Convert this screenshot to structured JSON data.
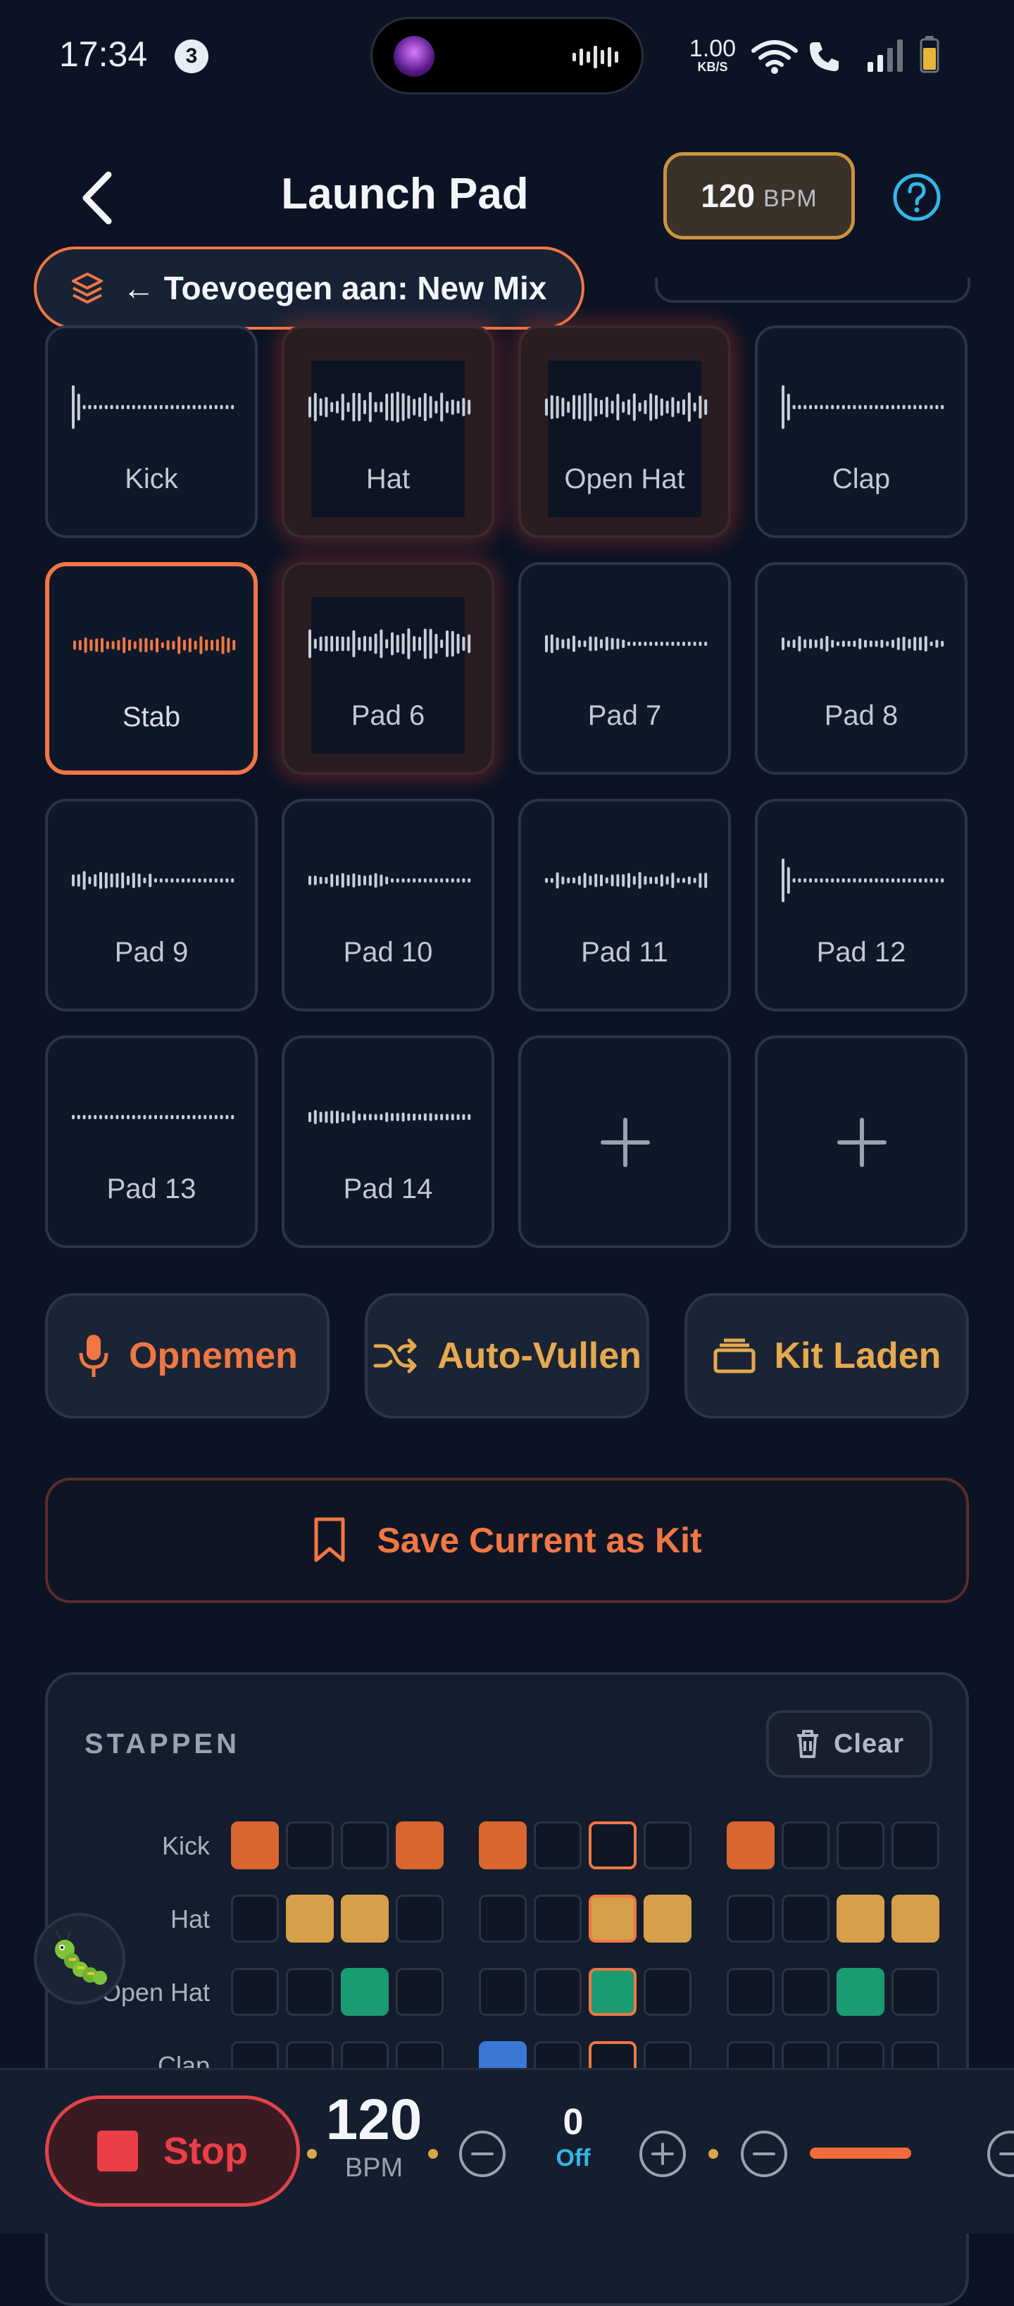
{
  "status_bar": {
    "time": "17:34",
    "notification_count": "3",
    "net_speed_value": "1.00",
    "net_speed_unit": "KB/S"
  },
  "header": {
    "title": "Launch Pad",
    "bpm_value": "120",
    "bpm_unit": "BPM"
  },
  "banner": {
    "text": "← Toevoegen aan: New Mix"
  },
  "pads": [
    {
      "label": "Kick"
    },
    {
      "label": "Hat"
    },
    {
      "label": "Open Hat"
    },
    {
      "label": "Clap"
    },
    {
      "label": "Stab"
    },
    {
      "label": "Pad 6"
    },
    {
      "label": "Pad 7"
    },
    {
      "label": "Pad 8"
    },
    {
      "label": "Pad 9"
    },
    {
      "label": "Pad 10"
    },
    {
      "label": "Pad 11"
    },
    {
      "label": "Pad 12"
    },
    {
      "label": "Pad 13"
    },
    {
      "label": "Pad 14"
    }
  ],
  "actions": {
    "record": "Opnemen",
    "autofill": "Auto-Vullen",
    "load_kit": "Kit Laden",
    "save_kit": "Save Current as Kit"
  },
  "steps": {
    "title": "STAPPEN",
    "clear_label": "Clear",
    "rows": [
      {
        "label": "Kick",
        "color": "#d9652f"
      },
      {
        "label": "Hat",
        "color": "#d6a04a"
      },
      {
        "label": "Open Hat",
        "color": "#1b9b72"
      },
      {
        "label": "Clap",
        "color": "#3b78d6"
      }
    ]
  },
  "transport": {
    "stop_label": "Stop",
    "bpm_value": "120",
    "bpm_unit": "BPM",
    "offset_value": "0",
    "offset_label": "Off"
  },
  "colors": {
    "accent": "#f07744",
    "amber": "#d6a04a",
    "background": "#0b1324",
    "stop_red": "#ea3f47",
    "info_blue": "#35b7e8"
  }
}
